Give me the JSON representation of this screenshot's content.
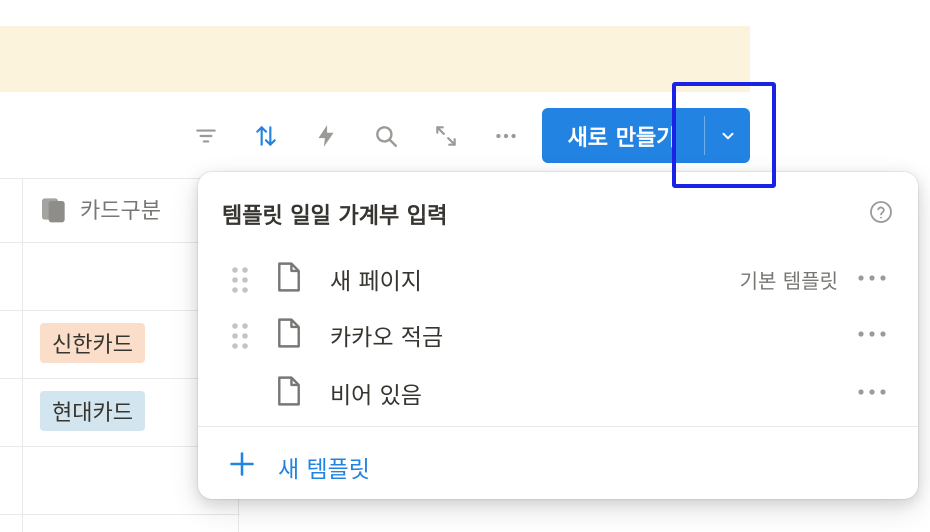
{
  "toolbar": {
    "icons": [
      "filter-icon",
      "sort-icon",
      "automation-icon",
      "search-icon",
      "expand-icon",
      "more-icon"
    ],
    "new_button": {
      "label": "새로 만들기",
      "chevron_icon": "chevron-down-icon"
    }
  },
  "table": {
    "column_header": "카드구분",
    "column_icon": "multi-select-icon",
    "tags": [
      {
        "label": "신한카드",
        "color": "#fadec9"
      },
      {
        "label": "현대카드",
        "color": "#d3e5ef"
      }
    ]
  },
  "dropdown": {
    "title": "템플릿 일일 가계부 입력",
    "help_icon": "help-circle-icon",
    "templates": [
      {
        "name": "새 페이지",
        "badge": "기본 템플릿",
        "draggable": true
      },
      {
        "name": "카카오 적금",
        "badge": "",
        "draggable": true
      },
      {
        "name": "비어 있음",
        "badge": "",
        "draggable": false
      }
    ],
    "add_label": "새 템플릿"
  },
  "colors": {
    "accent": "#2383e2",
    "banner": "#fbf3db",
    "annotation": "#1a22e6"
  }
}
